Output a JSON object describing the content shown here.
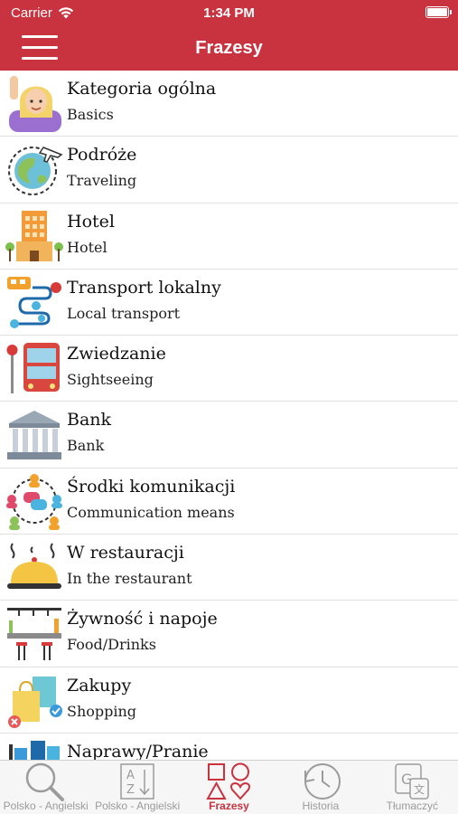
{
  "status_bar": {
    "carrier": "Carrier",
    "time": "1:34 PM"
  },
  "nav": {
    "title": "Frazesy",
    "menu_icon": "hamburger-menu-icon"
  },
  "categories": [
    {
      "pl": "Kategoria ogólna",
      "en": "Basics",
      "icon": "person-raising-hand-icon"
    },
    {
      "pl": "Podróże",
      "en": "Traveling",
      "icon": "globe-airplane-icon"
    },
    {
      "pl": "Hotel",
      "en": "Hotel",
      "icon": "hotel-building-icon"
    },
    {
      "pl": "Transport lokalny",
      "en": "Local transport",
      "icon": "bus-route-icon"
    },
    {
      "pl": "Zwiedzanie",
      "en": "Sightseeing",
      "icon": "sightseeing-bus-icon"
    },
    {
      "pl": "Bank",
      "en": "Bank",
      "icon": "bank-building-icon"
    },
    {
      "pl": "Środki komunikacji",
      "en": "Communication means",
      "icon": "people-chat-icon"
    },
    {
      "pl": "W restauracji",
      "en": "In the restaurant",
      "icon": "food-cloche-icon"
    },
    {
      "pl": "Żywność i napoje",
      "en": "Food/Drinks",
      "icon": "bar-counter-icon"
    },
    {
      "pl": "Zakupy",
      "en": "Shopping",
      "icon": "shopping-bags-icon"
    },
    {
      "pl": "Naprawy/Pranie",
      "en": "",
      "icon": "laundry-icon"
    }
  ],
  "tabs": [
    {
      "label": "Polsko - Angielski",
      "icon": "magnifier-icon",
      "active": false
    },
    {
      "label": "Polsko - Angielski",
      "icon": "sort-az-icon",
      "active": false
    },
    {
      "label": "Frazesy",
      "icon": "shapes-icon",
      "active": true
    },
    {
      "label": "Historia",
      "icon": "history-clock-icon",
      "active": false
    },
    {
      "label": "Tłumaczyć",
      "icon": "translate-icon",
      "active": false
    }
  ],
  "colors": {
    "brand": "#c9323f",
    "tab_inactive": "#9b9b9b",
    "divider": "#e2e2e2"
  }
}
